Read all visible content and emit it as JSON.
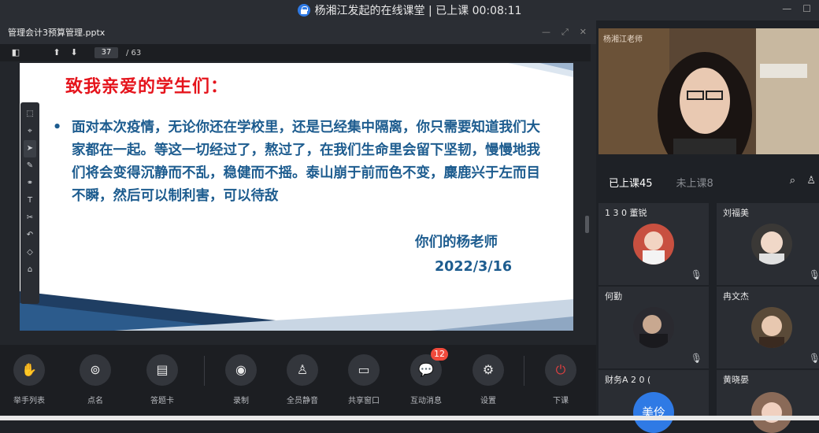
{
  "window": {
    "title": "杨湘江发起的在线课堂 | 已上课 00:08:11"
  },
  "document": {
    "filename": "管理会计3预算管理.pptx",
    "current_page": "37",
    "total_pages": "/ 63"
  },
  "slide": {
    "title": "致我亲爱的学生们：",
    "bullet": "•",
    "body": "面对本次疫情，无论你还在学校里，还是已经集中隔离，你只需要知道我们大家都在一起。等这一切经过了，熬过了，在我们生命里会留下坚韧，慢慢地我们将会变得沉静而不乱，稳健而不摇。泰山崩于前而色不变，麋鹿兴于左而目不瞬，然后可以制利害，可以待敌",
    "signature": "你们的杨老师",
    "date": "2022/3/16"
  },
  "toolbar": {
    "hand": "举手列表",
    "rollcall": "点名",
    "answer_card": "答题卡",
    "record": "录制",
    "mute_all": "全员静音",
    "share_window": "共享窗口",
    "messages": "互动消息",
    "messages_badge": "12",
    "settings": "设置",
    "end_class": "下课"
  },
  "panel": {
    "teacher_label": "杨湘江老师",
    "tab_in": "已上课45",
    "tab_out": "未上课8",
    "students": [
      {
        "name": "1 3 0 董锐"
      },
      {
        "name": "刘福美"
      },
      {
        "name": "何勤"
      },
      {
        "name": "冉文杰"
      },
      {
        "name": "财务A 2 0 ("
      },
      {
        "name": "黄晓晏"
      }
    ],
    "avatar_text": "美伶"
  },
  "colors": {
    "accent": "#2f7ae5",
    "slide_title": "#e5141c",
    "slide_body": "#1d5c8f",
    "badge": "#f14a3c",
    "end_class": "#e04040"
  }
}
